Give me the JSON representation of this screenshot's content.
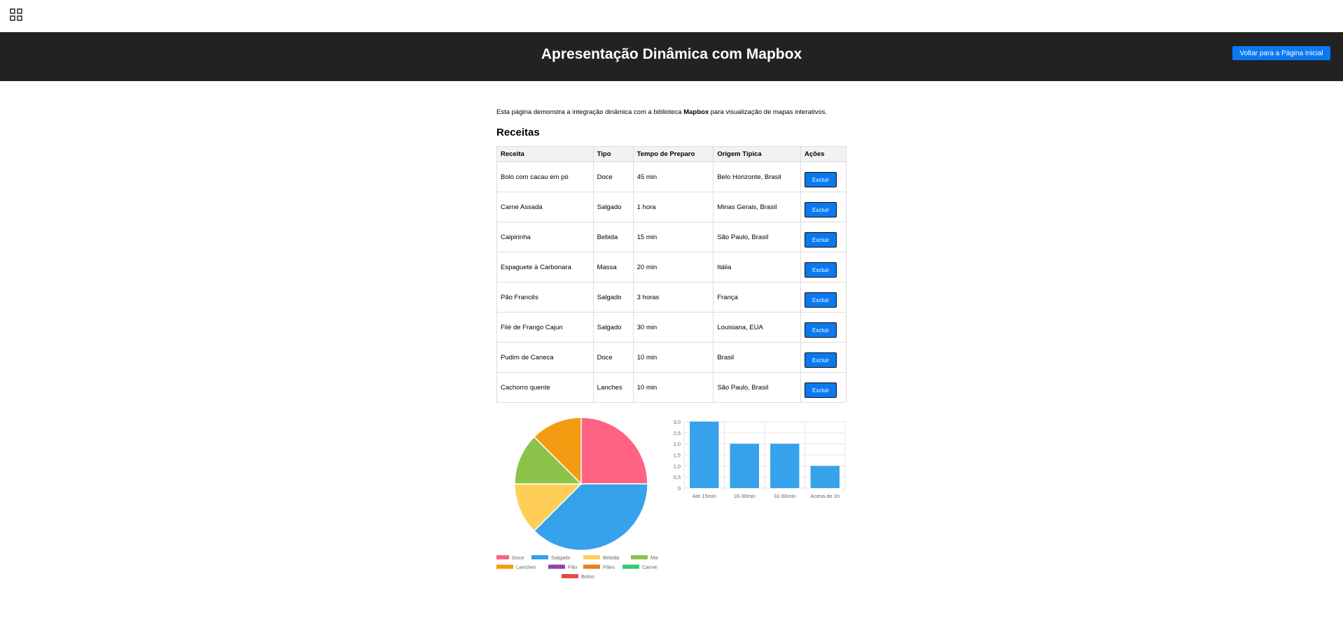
{
  "toolbar": {
    "apps_icon": "grid-icon"
  },
  "header": {
    "title": "Apresentação Dinâmica com Mapbox",
    "home_button_label": "Voltar para a Página Inicial"
  },
  "intro": {
    "text_before": "Esta página demonstra a integração dinâmica com a biblioteca ",
    "bold": "Mapbox",
    "text_after": " para visualização de mapas interativos."
  },
  "recipes": {
    "title": "Receitas",
    "columns": [
      "Receita",
      "Tipo",
      "Tempo de Preparo",
      "Origem Típica",
      "Ações"
    ],
    "delete_label": "Excluir",
    "rows": [
      {
        "name": "Bolo com cacau em pó",
        "type": "Doce",
        "time": "45 min",
        "origin": "Belo Horizonte, Brasil"
      },
      {
        "name": "Carne Assada",
        "type": "Salgado",
        "time": "1 hora",
        "origin": "Minas Gerais, Brasil"
      },
      {
        "name": "Caipirinha",
        "type": "Bebida",
        "time": "15 min",
        "origin": "São Paulo, Brasil"
      },
      {
        "name": "Espaguete à Carbonara",
        "type": "Massa",
        "time": "20 min",
        "origin": "Itália"
      },
      {
        "name": "Pão Francês",
        "type": "Salgado",
        "time": "3 horas",
        "origin": "França"
      },
      {
        "name": "Filé de Frango Cajun",
        "type": "Salgado",
        "time": "30 min",
        "origin": "Louisiana, EUA"
      },
      {
        "name": "Pudim de Caneca",
        "type": "Doce",
        "time": "10 min",
        "origin": "Brasil"
      },
      {
        "name": "Cachorro quente",
        "type": "Lanches",
        "time": "10 min",
        "origin": "São Paulo, Brasil"
      }
    ]
  },
  "chart_data": [
    {
      "type": "pie",
      "categories": [
        "Doce",
        "Salgado",
        "Bebida",
        "Massa",
        "Lanches",
        "Pão",
        "Pães",
        "Carnes",
        "Bolos"
      ],
      "values": [
        2,
        3,
        1,
        1,
        1,
        0,
        0,
        0,
        0
      ],
      "colors": [
        "#ff6384",
        "#36a2eb",
        "#ffce56",
        "#8bc34a",
        "#f39c12",
        "#8e44ad",
        "#e67e22",
        "#2ecc71",
        "#e74c3c"
      ],
      "legend": "bottom"
    },
    {
      "type": "bar",
      "categories": [
        "Até 15min",
        "16-30min",
        "31-60min",
        "Acima de 1h"
      ],
      "values": [
        3,
        2,
        2,
        1
      ],
      "ylim": [
        0,
        3
      ],
      "yticks": [
        "0",
        "0,5",
        "1,0",
        "1,5",
        "2,0",
        "2,5",
        "3,0"
      ],
      "color": "#36a2eb",
      "grid": true
    }
  ]
}
